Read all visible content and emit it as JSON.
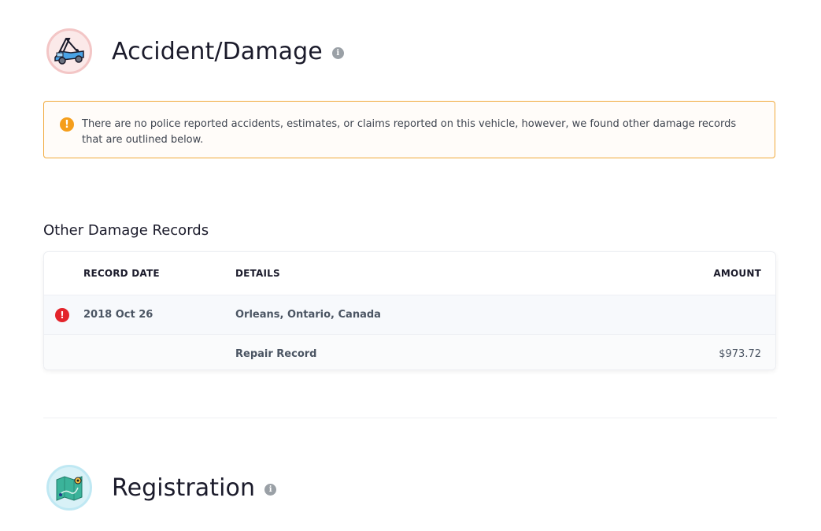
{
  "accident_section": {
    "title": "Accident/Damage",
    "icon": "tow-truck-icon",
    "info_icon": "info-icon"
  },
  "alert": {
    "icon": "warning-icon",
    "text": "There are no police reported accidents, estimates, or claims reported on this vehicle, however, we found other damage records that are outlined below.",
    "border_color": "#f0a93b"
  },
  "other_damage": {
    "title": "Other Damage Records",
    "columns": {
      "date": "RECORD DATE",
      "details": "DETAILS",
      "amount": "AMOUNT"
    },
    "records": [
      {
        "date": "2018 Oct 26",
        "location": "Orleans, Ontario, Canada",
        "entry": "Repair Record",
        "amount": "$973.72",
        "status_color": "#e3242b"
      }
    ]
  },
  "registration_section": {
    "title": "Registration",
    "icon": "map-icon",
    "info_icon": "info-icon"
  }
}
